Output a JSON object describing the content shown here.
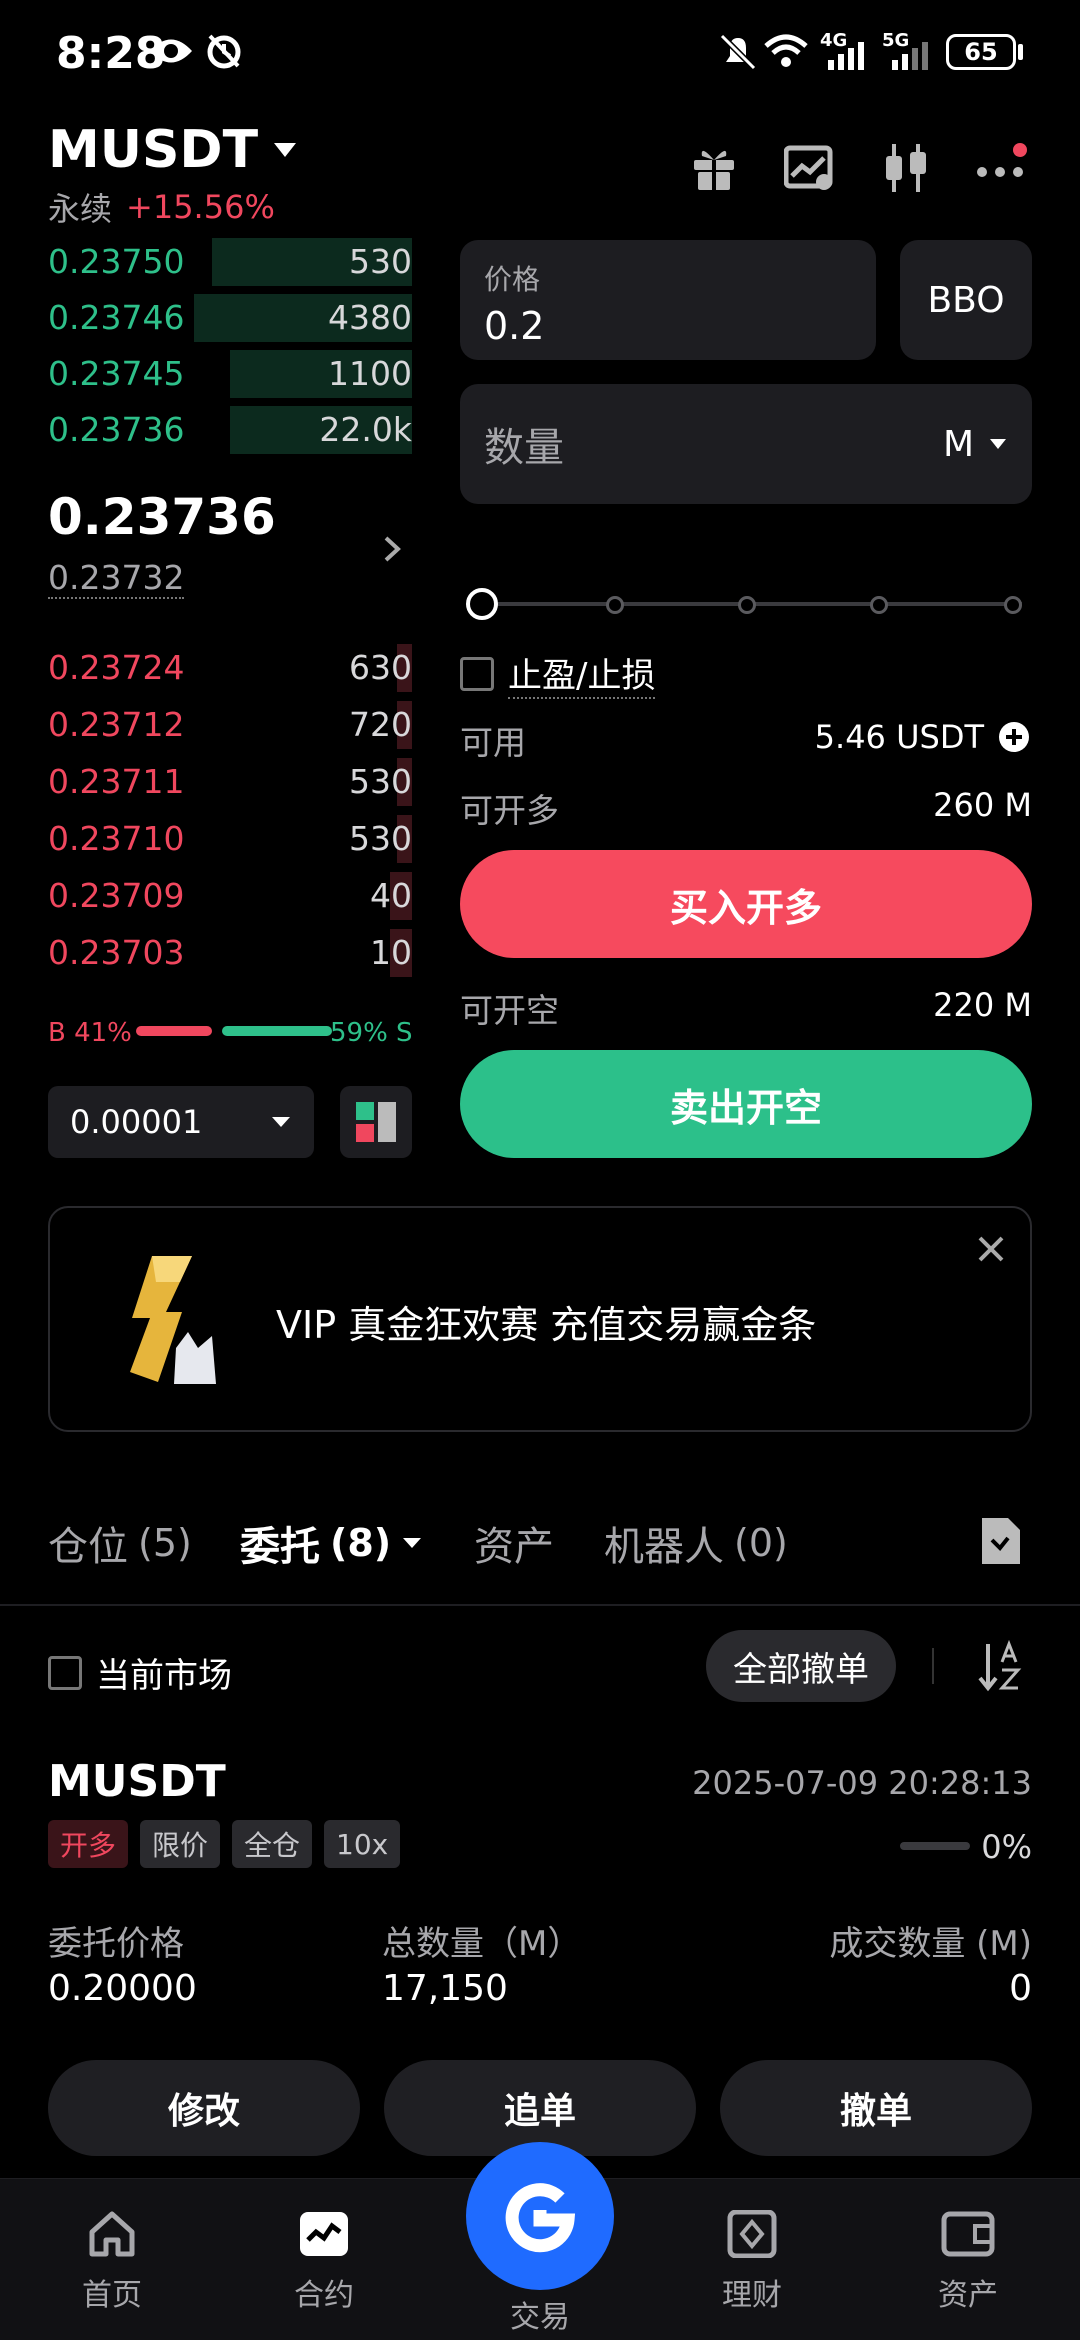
{
  "status_bar": {
    "time": "8:28",
    "battery": "65",
    "signal1": "4G",
    "signal2": "5G"
  },
  "header": {
    "symbol": "MUSDT",
    "contract_type": "永续",
    "change": "+15.56%"
  },
  "order_book": {
    "asks": [
      {
        "price": "0.23750",
        "qty": "530",
        "depth": 0.55
      },
      {
        "price": "0.23746",
        "qty": "4380",
        "depth": 0.6
      },
      {
        "price": "0.23745",
        "qty": "1100",
        "depth": 0.5
      },
      {
        "price": "0.23736",
        "qty": "22.0k",
        "depth": 0.5
      }
    ],
    "last_price": "0.23736",
    "mark_price": "0.23732",
    "bids": [
      {
        "price": "0.23724",
        "qty": "630",
        "depth": 0.04
      },
      {
        "price": "0.23712",
        "qty": "720",
        "depth": 0.04
      },
      {
        "price": "0.23711",
        "qty": "530",
        "depth": 0.04
      },
      {
        "price": "0.23710",
        "qty": "530",
        "depth": 0.04
      },
      {
        "price": "0.23709",
        "qty": "40",
        "depth": 0.06
      },
      {
        "price": "0.23703",
        "qty": "10",
        "depth": 0.06
      }
    ],
    "buy_ratio_label": "B 41%",
    "sell_ratio_label": "59% S",
    "buy_ratio": 0.41,
    "precision": "0.00001"
  },
  "order_form": {
    "price_label": "价格",
    "price_value": "0.2",
    "bbo_label": "BBO",
    "qty_placeholder": "数量",
    "qty_unit": "M",
    "tpsl_label": "止盈/止损",
    "available_label": "可用",
    "available_value": "5.46 USDT",
    "can_long_label": "可开多",
    "can_long_value": "260 M",
    "buy_button": "买入开多",
    "can_short_label": "可开空",
    "can_short_value": "220 M",
    "sell_button": "卖出开空"
  },
  "banner": {
    "text": "VIP 真金狂欢赛 充值交易赢金条"
  },
  "tabs": [
    {
      "label": "仓位",
      "count": "(5)"
    },
    {
      "label": "委托",
      "count": "(8)"
    },
    {
      "label": "资产",
      "count": ""
    },
    {
      "label": "机器人",
      "count": "(0)"
    }
  ],
  "orders_toolbar": {
    "current_market": "当前市场",
    "cancel_all": "全部撤单"
  },
  "order_card": {
    "symbol": "MUSDT",
    "time": "2025-07-09 20:28:13",
    "tags": [
      "开多",
      "限价",
      "全仓",
      "10x"
    ],
    "fill_percent": "0%",
    "col1_label": "委托价格",
    "col1_value": "0.20000",
    "col2_label": "总数量（M）",
    "col2_value": "17,150",
    "col3_label": "成交数量 (M)",
    "col3_value": "0",
    "btn_modify": "修改",
    "btn_chase": "追单",
    "btn_cancel": "撤单"
  },
  "bottom_nav": [
    "首页",
    "合约",
    "交易",
    "理财",
    "资产"
  ],
  "colors": {
    "green": "#2ec08a",
    "red": "#f0475e",
    "nav_center": "#1f6bff"
  }
}
